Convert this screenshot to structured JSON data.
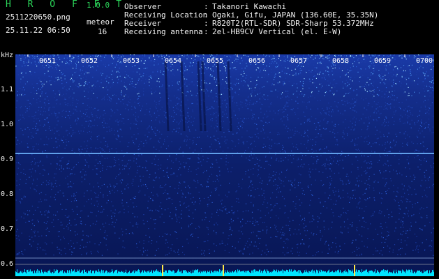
{
  "header": {
    "app_title": "H R O F F T",
    "version": "1.0.0",
    "filename": "2511220650.png",
    "timestamp": "25.11.22 06:50",
    "detector_label": "meteor",
    "detector_count": "16"
  },
  "info": [
    {
      "label": "Observer",
      "value": "Takanori Kawachi"
    },
    {
      "label": "Receiving Location",
      "value": "Ogaki, Gifu, JAPAN (136.60E, 35.35N)"
    },
    {
      "label": "Receiver",
      "value": "R820T2(RTL-SDR) SDR-Sharp 53.372MHz"
    },
    {
      "label": "Receiving antenna",
      "value": "2el-HB9CV Vertical (el. E-W)"
    }
  ],
  "axis": {
    "unit": "kHz",
    "freq_ticks": [
      "1.1",
      "1.0",
      "0.9",
      "0.8",
      "0.7",
      "0.6"
    ],
    "time_ticks": [
      "0651",
      "0652",
      "0653",
      "0654",
      "0655",
      "0656",
      "0657",
      "0658",
      "0659",
      "0700"
    ]
  },
  "colors": {
    "background": "#000000",
    "spectrum_base": "#0a1a6e",
    "spectrum_hot": "#8fd6ff",
    "carrier_line": "#6fb6ff",
    "header_green": "#2bd65a",
    "baseline_cyan": "#00e5ff"
  }
}
